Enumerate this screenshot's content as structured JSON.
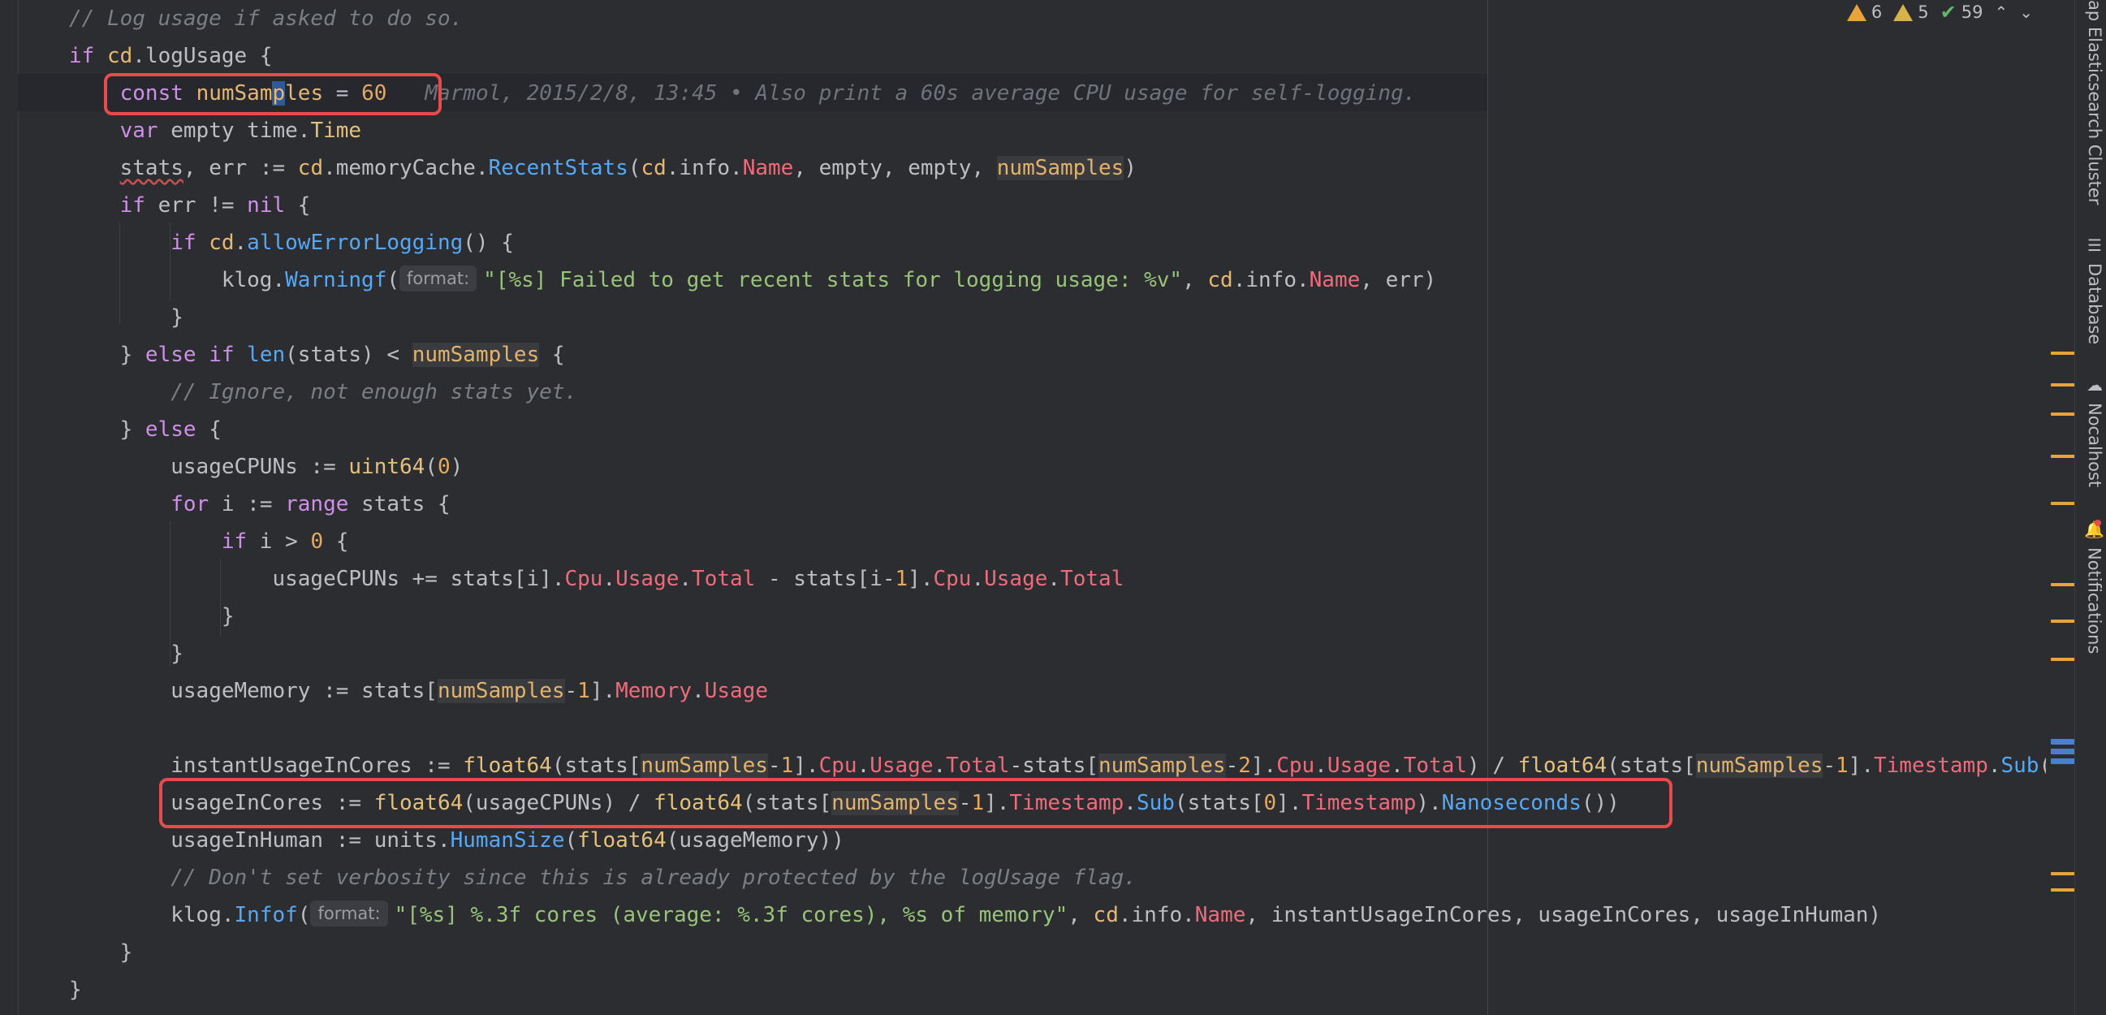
{
  "colors": {
    "background": "#2b2d31",
    "keyword": "#cf8ee8",
    "function": "#56a8f5",
    "string": "#98c379",
    "comment": "#7a7e85",
    "highlight": "#e84b4b",
    "warning": "#e8a33b"
  },
  "status": {
    "warnings": "6",
    "weak_warnings": "5",
    "checks": "59",
    "up_icon": "chevron-up-icon",
    "down_icon": "chevron-down-icon"
  },
  "side_tabs": {
    "elasticsearch": "ap Elasticsearch Cluster",
    "database": "Database",
    "nocalhost": "Nocalhost",
    "notifications": "Notifications"
  },
  "hints": {
    "format": "format:"
  },
  "blame": "Marmol, 2015/2/8, 13:45 • Also print a 60s average CPU usage for self-logging.",
  "code": {
    "l0_comment": "// Log usage if asked to do so.",
    "l11_comment": "// Ignore, not enough stats yet.",
    "l23_comment": "// Don't set verbosity since this is already protected by the logUsage flag.",
    "kw_if": "if",
    "kw_const": "const",
    "kw_var": "var",
    "kw_nil": "nil",
    "kw_else": "else",
    "kw_for": "for",
    "kw_range": "range",
    "cd": "cd",
    "logUsage": "logUsage",
    "numSamples": "numSamples",
    "sixty": "60",
    "empty_time": " empty time.",
    "Time": "Time",
    "stats_err": "stats",
    "err_assign": ", err := ",
    "memoryCache": ".memoryCache.",
    "RecentStats": "RecentStats",
    "info": ".info.",
    "Name": "Name",
    "empty_empty": ", empty, empty, ",
    "err_neq": " err != ",
    "allowErrorLogging": "allowErrorLogging",
    "klog": "klog.",
    "Warningf": "Warningf",
    "warn_string": "\"[%s] Failed to get recent stats for logging usage: %v\"",
    "err_close": ", err)",
    "len": "len",
    "usageCPUNs_decl": "usageCPUNs := ",
    "uint64": "uint64",
    "zero": "0",
    "one": "1",
    "two": "2",
    "i_assign": " i := ",
    "stats_brace": " stats {",
    "i_gt": " i > ",
    "usageCPUNs_add": "usageCPUNs += stats[i].",
    "Cpu": "Cpu",
    "Usage": "Usage",
    "Total": "Total",
    "minus_stats": " - stats[i-",
    "usageMemory_decl": "usageMemory := stats[",
    "Memory": "Memory",
    "instant_decl": "instantUsageInCores := ",
    "float64": "float64",
    "Timestamp": "Timestamp",
    "Sub": "Sub",
    "Nanoseconds": "Nanoseconds",
    "usageInCores_decl": "usageInCores := ",
    "usageCPUNs_arg": "(usageCPUNs) / ",
    "usageInHuman_decl": "usageInHuman := units.",
    "HumanSize": "HumanSize",
    "usageMemory_arg": "(usageMemory))",
    "Infof": "Infof",
    "info_string": "\"[%s] %.3f cores (average: %.3f cores), %s of memory\"",
    "info_args": ", instantUsageInCores, usageInCores, usageInHuman)"
  }
}
